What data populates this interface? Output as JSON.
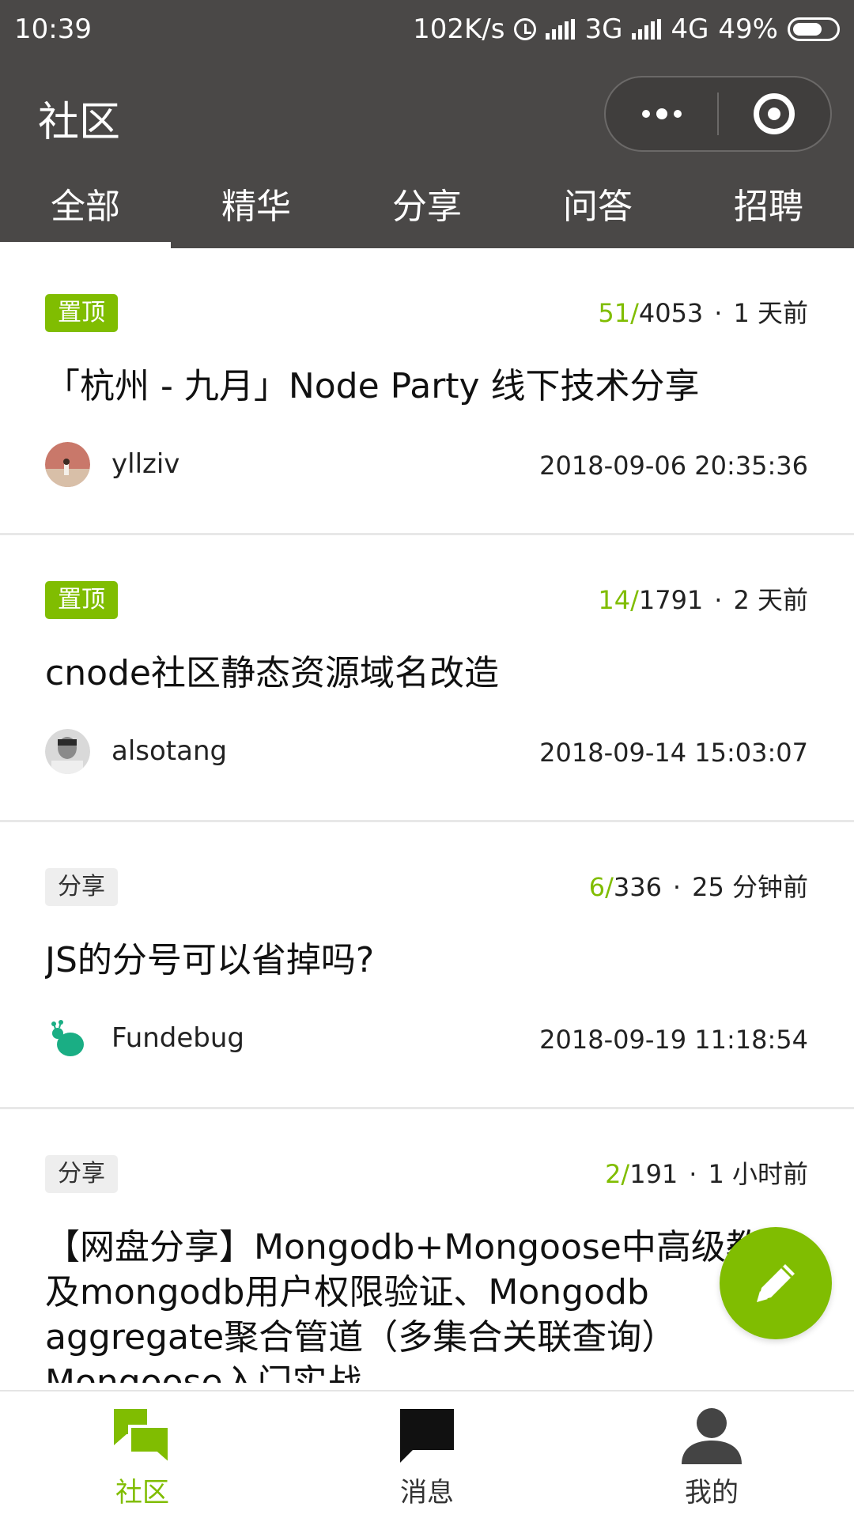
{
  "status_bar": {
    "time": "10:39",
    "net_speed": "102K/s",
    "network_1": "3G",
    "network_2": "4G",
    "battery": "49%"
  },
  "nav": {
    "title": "社区"
  },
  "tabs": [
    {
      "label": "全部",
      "active": true
    },
    {
      "label": "精华"
    },
    {
      "label": "分享"
    },
    {
      "label": "问答"
    },
    {
      "label": "招聘"
    }
  ],
  "topics": [
    {
      "badge": "置顶",
      "badge_type": "pin",
      "reply_count": "51",
      "view_count": "4053",
      "time_ago": "1 天前",
      "title": "「杭州 - 九月」Node Party 线下技术分享",
      "author": "yllziv",
      "date": "2018-09-06 20:35:36"
    },
    {
      "badge": "置顶",
      "badge_type": "pin",
      "reply_count": "14",
      "view_count": "1791",
      "time_ago": "2 天前",
      "title": "cnode社区静态资源域名改造",
      "author": "alsotang",
      "date": "2018-09-14 15:03:07"
    },
    {
      "badge": "分享",
      "badge_type": "share",
      "reply_count": "6",
      "view_count": "336",
      "time_ago": "25 分钟前",
      "title": "JS的分号可以省掉吗?",
      "author": "Fundebug",
      "date": "2018-09-19 11:18:54"
    },
    {
      "badge": "分享",
      "badge_type": "share",
      "reply_count": "2",
      "view_count": "191",
      "time_ago": "1 小时前",
      "title": "【网盘分享】Mongodb+Mongoose中高级教程及mongodb用户权限验证、Mongodb aggregate聚合管道（多集合关联查询） Mongoose入门实战"
    }
  ],
  "tabbar": [
    {
      "label": "社区",
      "icon": "community-icon",
      "active": true
    },
    {
      "label": "消息",
      "icon": "message-icon"
    },
    {
      "label": "我的",
      "icon": "user-icon"
    }
  ],
  "colors": {
    "header": "#4a4847",
    "accent": "#80bd01",
    "fundebug": "#1aae84"
  }
}
